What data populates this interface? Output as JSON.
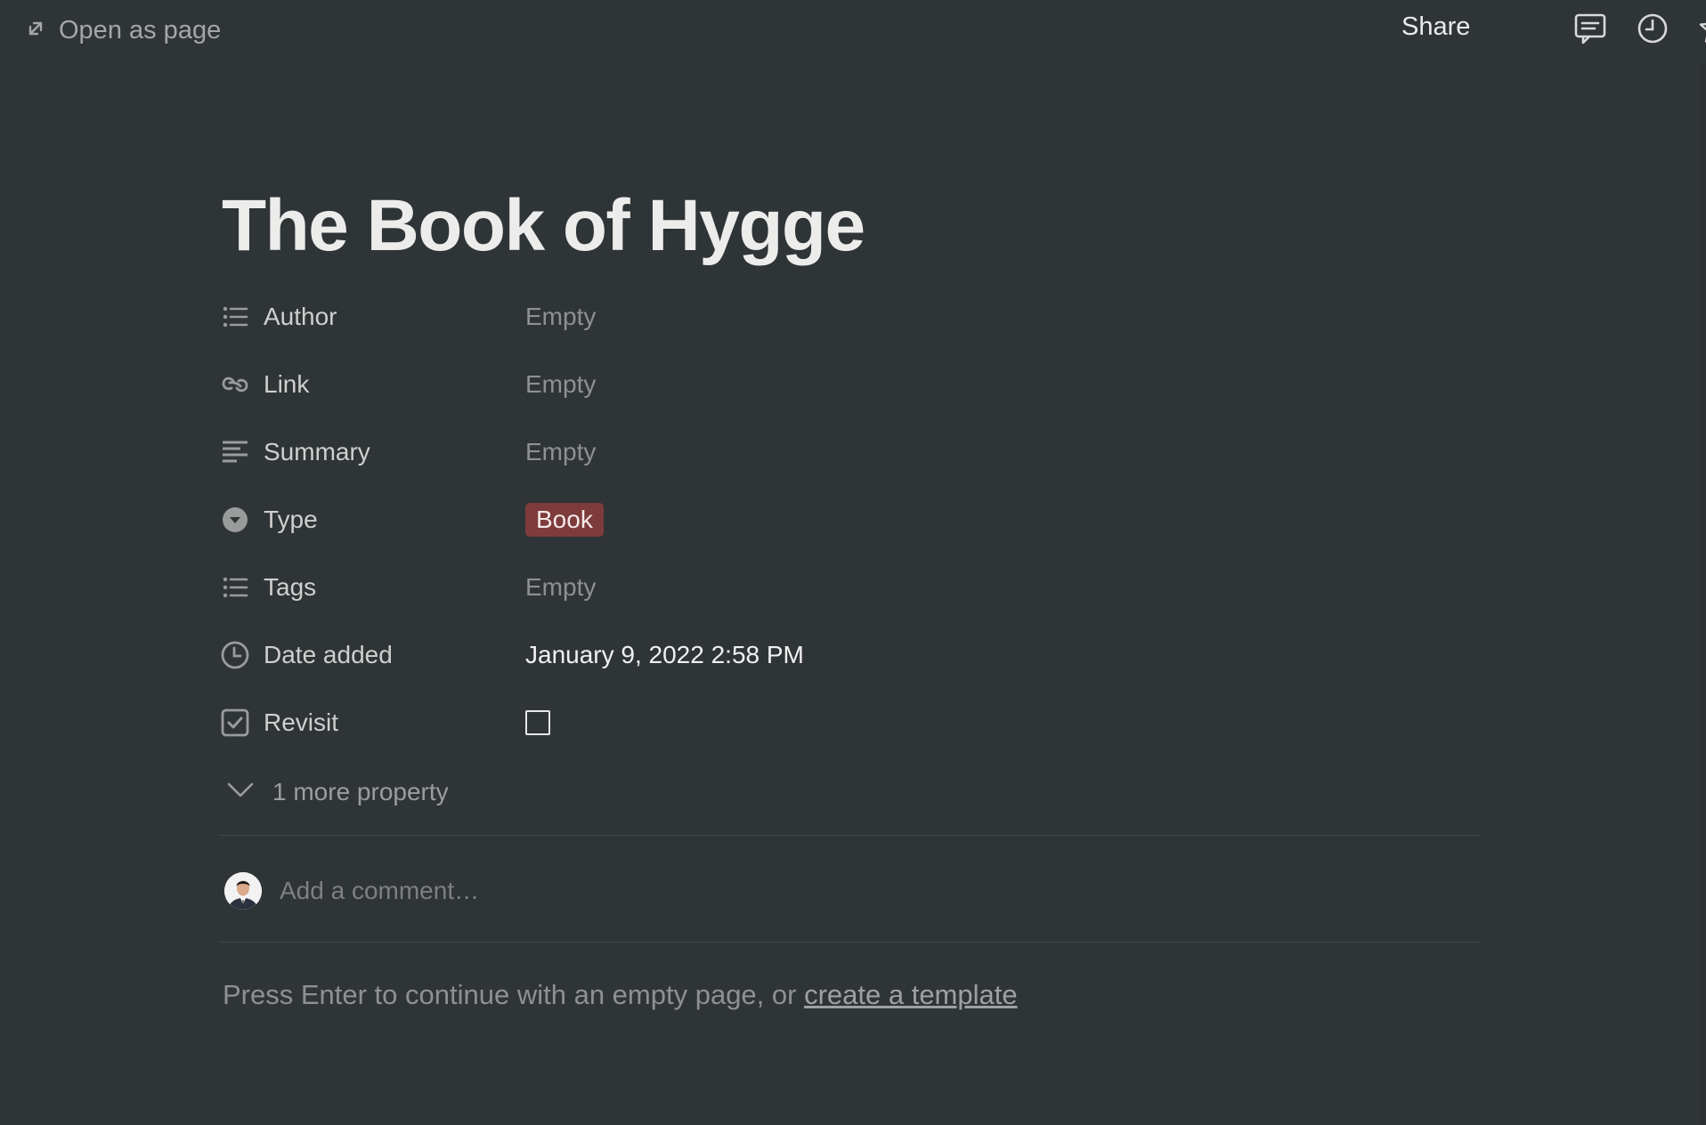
{
  "topbar": {
    "open_as_page_label": "Open as page",
    "share_label": "Share",
    "icons": [
      "expand-icon",
      "comment-icon",
      "clock-icon",
      "star-icon",
      "more-icon"
    ]
  },
  "page": {
    "title": "The Book of Hygge"
  },
  "properties": [
    {
      "name": "Author",
      "icon": "list-icon",
      "value": "Empty"
    },
    {
      "name": "Link",
      "icon": "link-icon",
      "value": "Empty"
    },
    {
      "name": "Summary",
      "icon": "text-icon",
      "value": "Empty"
    },
    {
      "name": "Type",
      "icon": "select-icon",
      "value": "Book"
    },
    {
      "name": "Tags",
      "icon": "list-icon",
      "value": "Empty"
    },
    {
      "name": "Date added",
      "icon": "clock-icon",
      "value": "January 9, 2022 2:58 PM"
    },
    {
      "name": "Revisit",
      "icon": "checkbox-icon",
      "checked": false
    }
  ],
  "more_properties_label": "1 more property",
  "comment": {
    "placeholder": "Add a comment…"
  },
  "footer": {
    "prompt_text": "Press Enter to continue with an empty page, or ",
    "template_link": "create a template"
  },
  "colors": {
    "background": "#2f3437",
    "type_tag_bg": "#7d3b3b",
    "text_primary": "#ececeb",
    "text_muted": "#8f9090"
  }
}
